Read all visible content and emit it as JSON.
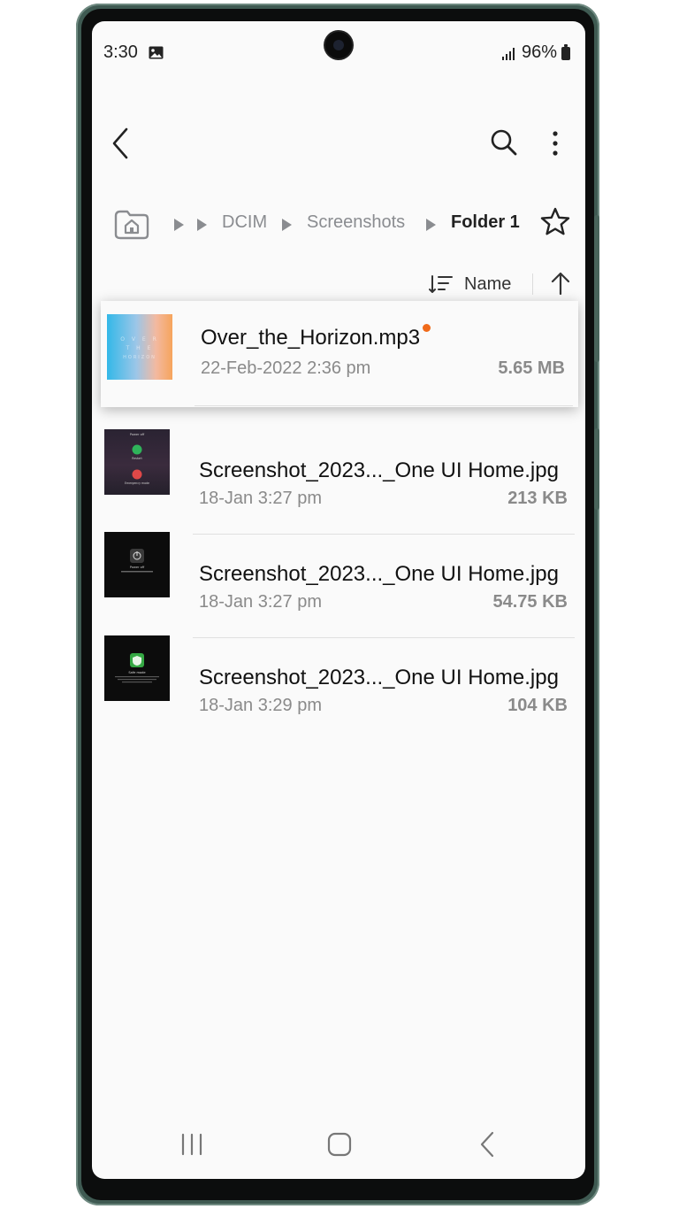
{
  "status_bar": {
    "time": "3:30",
    "battery_percent": "96%",
    "icons": [
      "gallery-notification-icon",
      "signal-icon",
      "battery-icon"
    ]
  },
  "toolbar": {
    "back_icon": "back-chevron-icon",
    "search_icon": "search-icon",
    "more_icon": "more-vertical-icon"
  },
  "breadcrumb": {
    "home_icon": "home-folder-icon",
    "items": [
      "DCIM",
      "Screenshots",
      "Folder 1"
    ],
    "favorite_icon": "star-outline-icon"
  },
  "sort": {
    "label": "Name",
    "icon": "sort-lines-icon",
    "direction_icon": "arrow-up-icon"
  },
  "files": [
    {
      "name": "Over_the_Horizon.mp3",
      "meta": "22-Feb-2022 2:36 pm",
      "size": "5.65 MB",
      "new": true,
      "thumbnail": "album-art-gradient",
      "thumb_text": "OVER THE HORIZON"
    },
    {
      "name": "Screenshot_2023..._One UI Home.jpg",
      "meta": "18-Jan 3:27 pm",
      "size": "213 KB",
      "thumbnail": "power-menu-screenshot",
      "thumb_text": [
        "Power off",
        "Restart",
        "Emergency mode"
      ]
    },
    {
      "name": "Screenshot_2023..._One UI Home.jpg",
      "meta": "18-Jan 3:27 pm",
      "size": "54.75 KB",
      "thumbnail": "power-off-screenshot",
      "thumb_text": [
        "Power off"
      ]
    },
    {
      "name": "Screenshot_2023..._One UI Home.jpg",
      "meta": "18-Jan 3:29 pm",
      "size": "104 KB",
      "thumbnail": "safe-mode-screenshot",
      "thumb_text": [
        "Safe mode"
      ]
    }
  ],
  "colors": {
    "accent_new_dot": "#f06a1a",
    "frame": "#3f5a52",
    "screen_bg": "#fafafa",
    "secondary_text": "#8a8a8a"
  },
  "navigation_bar": {
    "icons": [
      "recent-apps-icon",
      "home-icon",
      "back-icon"
    ]
  }
}
